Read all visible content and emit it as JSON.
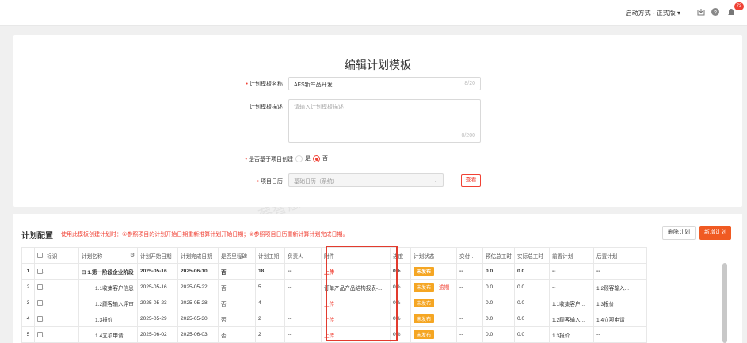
{
  "topbar": {
    "mode_label": "启动方式 - 正式版 ▾",
    "download_icon": "download-icon",
    "help_icon": "help-icon",
    "bell_icon": "bell-icon",
    "notification_count": "73"
  },
  "form": {
    "title": "编辑计划模板",
    "name_label": "计划模板名称",
    "name_value": "AFS新产品开发",
    "name_counter": "8/20",
    "desc_label": "计划模板描述",
    "desc_placeholder": "请输入计划模板描述",
    "desc_counter": "0/200",
    "project_create_label": "是否基于项目创建",
    "opt_yes": "是",
    "opt_no": "否",
    "calendar_label": "项目日历",
    "calendar_value": "基础日历（系统）",
    "view_button": "查看"
  },
  "plan": {
    "title": "计划配置",
    "tip": "使用此模板创建计划时：①参照项目的计划开始日期重新推算计划开始日期；②参照项目日历重新计算计划完成日期。",
    "delete_button": "删除计划",
    "new_button": "新增计划",
    "columns": [
      "标识",
      "计划名称",
      "计划开始日期",
      "计划完成日期",
      "是否里程碑",
      "计划工期",
      "负责人",
      "附件",
      "进度",
      "计划状态",
      "交付状态",
      "预估总工时",
      "实际总工时",
      "前置计划",
      "后置计划"
    ],
    "rows": [
      {
        "no": "1",
        "name": "⊟ 1.第一阶段企业阶段",
        "start": "2025-05-16",
        "end": "2025-06-10",
        "milestone": "否",
        "duration": "18",
        "owner": "--",
        "attachment": "上传",
        "progress": "0%",
        "status": "未发布",
        "overdue": "",
        "delivery": "--",
        "est": "0.0",
        "actual": "0.0",
        "pre": "--",
        "post": "--"
      },
      {
        "no": "2",
        "name": "1.1收集客户信息",
        "start": "2025-05-16",
        "end": "2025-05-22",
        "milestone": "否",
        "duration": "5",
        "owner": "--",
        "attachment": "订单产品产品结构报表-...",
        "progress": "0%",
        "status": "未发布",
        "overdue": "· 逾期",
        "delivery": "--",
        "est": "0.0",
        "actual": "0.0",
        "pre": "--",
        "post": "1.2顾客输入..."
      },
      {
        "no": "3",
        "name": "1.2顾客输入评审",
        "start": "2025-05-23",
        "end": "2025-05-28",
        "milestone": "否",
        "duration": "4",
        "owner": "--",
        "attachment": "上传",
        "progress": "0%",
        "status": "未发布",
        "overdue": "",
        "delivery": "--",
        "est": "0.0",
        "actual": "0.0",
        "pre": "1.1收集客户...",
        "post": "1.3报价"
      },
      {
        "no": "4",
        "name": "1.3报价",
        "start": "2025-05-29",
        "end": "2025-05-30",
        "milestone": "否",
        "duration": "2",
        "owner": "--",
        "attachment": "上传",
        "progress": "0%",
        "status": "未发布",
        "overdue": "",
        "delivery": "--",
        "est": "0.0",
        "actual": "0.0",
        "pre": "1.2顾客输入...",
        "post": "1.4立项申请"
      },
      {
        "no": "5",
        "name": "1.4立项申请",
        "start": "2025-06-02",
        "end": "2025-06-03",
        "milestone": "否",
        "duration": "2",
        "owner": "--",
        "attachment": "上传",
        "progress": "0%",
        "status": "未发布",
        "overdue": "",
        "delivery": "--",
        "est": "0.0",
        "actual": "0.0",
        "pre": "1.3报价",
        "post": "--"
      }
    ]
  },
  "colors": {
    "accent": "#f04134",
    "primary_button": "#f05a22",
    "status_badge": "#f5a623"
  }
}
